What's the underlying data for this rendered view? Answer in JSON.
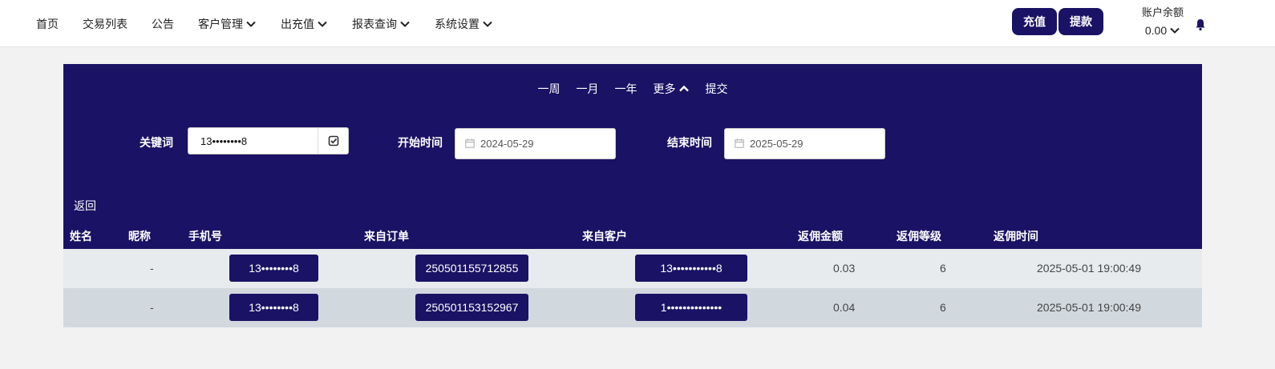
{
  "nav": {
    "items": [
      {
        "label": "首页",
        "dropdown": false
      },
      {
        "label": "交易列表",
        "dropdown": false
      },
      {
        "label": "公告",
        "dropdown": false
      },
      {
        "label": "客户管理",
        "dropdown": true
      },
      {
        "label": "出充值",
        "dropdown": true
      },
      {
        "label": "报表查询",
        "dropdown": true
      },
      {
        "label": "系统设置",
        "dropdown": true
      }
    ],
    "recharge_label": "充值",
    "withdraw_label": "提款",
    "balance_label": "账户余额",
    "balance_value": "0.00"
  },
  "filters": {
    "quick": [
      "一周",
      "一月",
      "一年",
      "更多",
      "提交"
    ],
    "keyword_label": "关键词",
    "keyword_value": "13••••••••8",
    "start_label": "开始时间",
    "start_value": "2024-05-29",
    "end_label": "结束时间",
    "end_value": "2025-05-29"
  },
  "back_label": "返回",
  "table": {
    "headers": [
      "姓名",
      "昵称",
      "手机号",
      "来自订单",
      "来自客户",
      "返佣金额",
      "返佣等级",
      "返佣时间"
    ],
    "rows": [
      {
        "name": "",
        "nickname": "-",
        "phone": "13••••••••8",
        "order": "250501155712855",
        "client": "13•••••••••••8",
        "amount": "0.03",
        "level": "6",
        "time": "2025-05-01 19:00:49"
      },
      {
        "name": "",
        "nickname": "-",
        "phone": "13••••••••8",
        "order": "250501153152967",
        "client": "1••••••••••••••",
        "amount": "0.04",
        "level": "6",
        "time": "2025-05-01 19:00:49"
      }
    ]
  },
  "colors": {
    "primary": "#1a1264",
    "row_odd": "#e8ebee",
    "row_even": "#d1d9df",
    "page_bg": "#f2f2f2"
  },
  "icons": {
    "dropdown": "chevron-down-icon",
    "more": "chevron-up-icon",
    "notifications": "bell-icon",
    "keyword_submit": "check-square-icon",
    "date": "calendar-icon"
  }
}
